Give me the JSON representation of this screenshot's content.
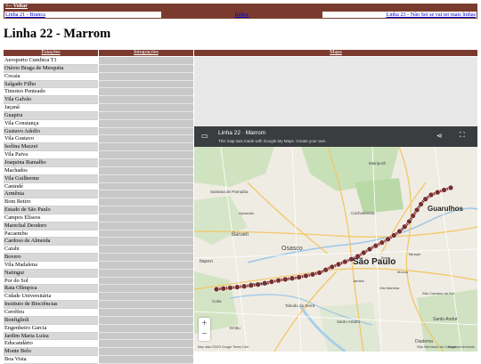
{
  "top": {
    "back_label": "<-- Voltar"
  },
  "nav": {
    "prev_label": "Linha 21 - Branca",
    "index_label": "Índice",
    "next_label": "Linha 23 - Não Sei se vai ter mais linhas"
  },
  "page_title": "Linha 22 - Marrom",
  "table": {
    "col_stations": "Estações",
    "col_integrations": "Integrações",
    "col_map": "Mapa",
    "stations": [
      "Aeroporto Cumbica T1",
      "Otávio Braga de Mesquita",
      "Cocaia",
      "Salgado Filho",
      "Timoteo Penteado",
      "Vila Galvão",
      "Jaçanã",
      "Guapira",
      "Vila Constança",
      "Gustavo Adolfo",
      "Vila Gustavo",
      "Isolina Mazzei",
      "Vila Paiva",
      "Joaquina Ramalho",
      "Machados",
      "Vila Guilherme",
      "Canindé",
      "Armênia",
      "Bom Retiro",
      "Estado de São Paulo",
      "Campos Elíseos",
      "Marechal Deodoro",
      "Pacaembu",
      "Cardoso de Almeida",
      "Caiubi",
      "Bovero",
      "Vila Madalena",
      "Natingui",
      "Por do Sol",
      "Raia Olímpica",
      "Cidade Universitária",
      "Instituto de Biociências",
      "Cerrêfeu",
      "Bonfiglioli",
      "Engenheiro Garcia",
      "Jardim Maria Luiza",
      "Educandário",
      "Monte Belo",
      "Boa Vista"
    ]
  },
  "map": {
    "title": "Linha 22 · Marrom",
    "subtitle": "This map was made with Google My Maps. Create your own.",
    "zoom_in": "+",
    "zoom_out": "−",
    "footer_left": "Map data ©2023 Google   Terms   2 km",
    "footer_right": "Keyboard shortcuts",
    "line_color": "#7a2e2e",
    "labels": [
      "Guarulhos",
      "São Paulo",
      "Osasco",
      "Barueri",
      "Itapevi",
      "Cotia",
      "Embu",
      "Taboão da Serra",
      "Santo André",
      "Diadema",
      "São Caetano do Sul",
      "Santana de Parnaíba",
      "Mairiporã",
      "Cachoeirinha",
      "Santo Amaro",
      "Jardins",
      "Vila Mariana",
      "Tatuapé",
      "Brás",
      "Mooca",
      "São Bernardo do Campo",
      "Carapicuíba",
      "Alphaville"
    ]
  }
}
